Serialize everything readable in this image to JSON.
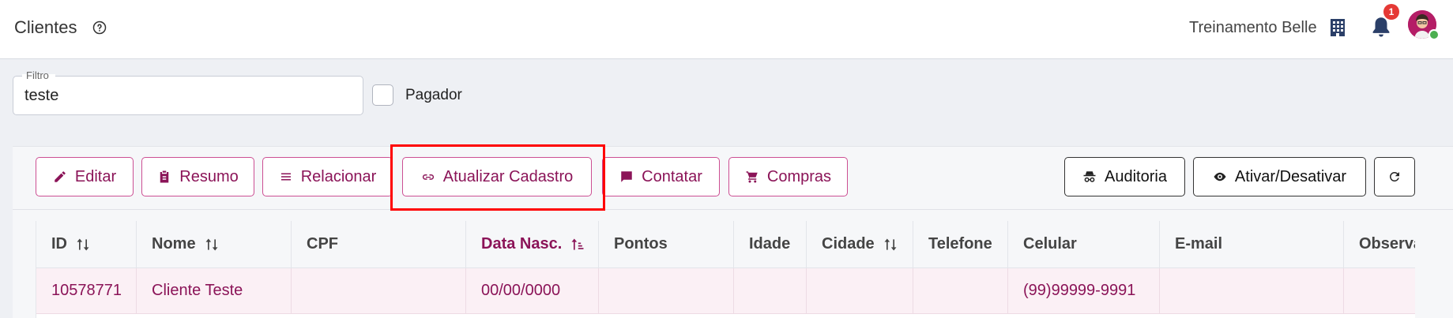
{
  "header": {
    "title": "Clientes",
    "org_name": "Treinamento Belle",
    "notification_count": "1"
  },
  "filter": {
    "label": "Filtro",
    "value": "teste",
    "pagador_label": "Pagador"
  },
  "toolbar": {
    "left_buttons": [
      {
        "label": "Editar",
        "icon": "pencil-icon"
      },
      {
        "label": "Resumo",
        "icon": "clipboard-icon"
      },
      {
        "label": "Relacionar",
        "icon": "list-icon"
      },
      {
        "label": "Atualizar Cadastro",
        "icon": "link-icon"
      },
      {
        "label": "Contatar",
        "icon": "chat-icon"
      },
      {
        "label": "Compras",
        "icon": "cart-icon"
      }
    ],
    "right_buttons": [
      {
        "label": "Auditoria",
        "icon": "spy-icon"
      },
      {
        "label": "Ativar/Desativar",
        "icon": "eye-icon"
      },
      {
        "label": "",
        "icon": "refresh-icon"
      }
    ]
  },
  "table": {
    "columns": [
      "ID",
      "Nome",
      "CPF",
      "Data Nasc.",
      "Pontos",
      "Idade",
      "Cidade",
      "Telefone",
      "Celular",
      "E-mail",
      "Observa"
    ],
    "rows": [
      [
        "10578771",
        "Cliente Teste",
        "",
        "00/00/0000",
        "",
        "",
        "",
        "",
        "(99)99999-9991",
        "",
        ""
      ]
    ]
  },
  "colors": {
    "accent": "#8b1458",
    "accent_border": "#cc4f93",
    "highlight": "#ff0000",
    "row_bg": "#fbf0f5"
  }
}
